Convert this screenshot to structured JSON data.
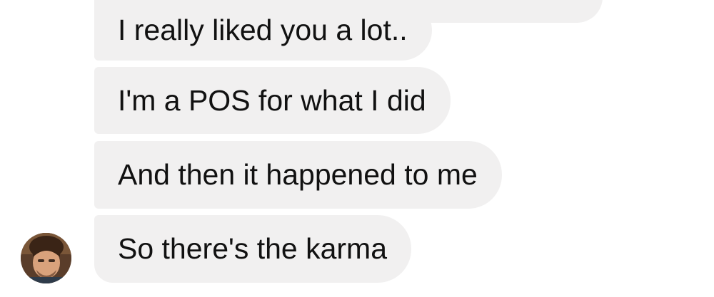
{
  "conversation": {
    "messages": [
      {
        "text": ""
      },
      {
        "text": "I really liked you a lot.."
      },
      {
        "text": "I'm a POS for what I did"
      },
      {
        "text": "And then it happened to me"
      },
      {
        "text": "So there's the karma"
      }
    ],
    "sender_avatar": "avatar-photo",
    "bubble_color": "#f1f0f0",
    "text_color": "#111111"
  }
}
